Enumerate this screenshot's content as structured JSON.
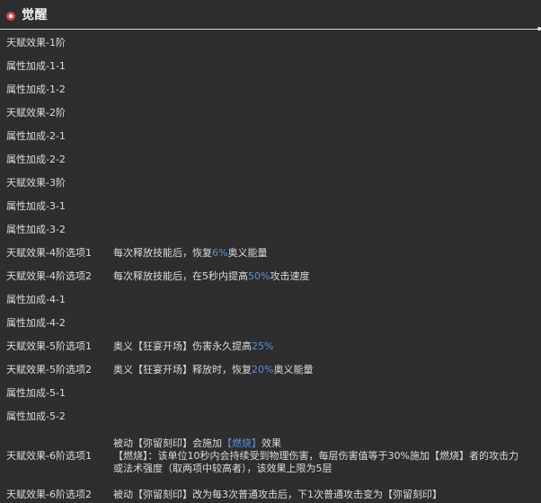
{
  "header": {
    "title": "觉醒",
    "icon": "awaken-bullet-icon",
    "accent_color": "#e0525a"
  },
  "rows": [
    {
      "label": "天赋效果-1阶"
    },
    {
      "label": "属性加成-1-1"
    },
    {
      "label": "属性加成-1-2"
    },
    {
      "label": "天赋效果-2阶"
    },
    {
      "label": "属性加成-2-1"
    },
    {
      "label": "属性加成-2-2"
    },
    {
      "label": "天赋效果-3阶"
    },
    {
      "label": "属性加成-3-1"
    },
    {
      "label": "属性加成-3-2"
    },
    {
      "label": "天赋效果-4阶选项1",
      "desc_pre": "每次释放技能后，恢复",
      "desc_hl": "6%",
      "desc_post": "奥义能量"
    },
    {
      "label": "天赋效果-4阶选项2",
      "desc_pre": "每次释放技能后，在5秒内提高",
      "desc_hl": "50%",
      "desc_post": "攻击速度"
    },
    {
      "label": "属性加成-4-1"
    },
    {
      "label": "属性加成-4-2"
    },
    {
      "label": "天赋效果-5阶选项1",
      "desc_pre": "奥义【狂宴开场】伤害永久提高",
      "desc_hl": "25%",
      "desc_post": ""
    },
    {
      "label": "天赋效果-5阶选项2",
      "desc_pre": "奥义【狂宴开场】释放时，恢复",
      "desc_hl": "20%",
      "desc_post": "奥义能量"
    },
    {
      "label": "属性加成-5-1"
    },
    {
      "label": "属性加成-5-2"
    }
  ],
  "row6_1": {
    "label": "天赋效果-6阶选项1",
    "line1_pre": "被动【弥留刻印】会施加",
    "line1_hl": "【燃烧】",
    "line1_post": "效果",
    "line2": "【燃烧】：该单位10秒内会持续受到物理伤害，每层伤害值等于30%施加【燃烧】者的攻击力",
    "line3": "或法术强度（取两项中较高者），该效果上限为5层"
  },
  "row6_2": {
    "label": "天赋效果-6阶选项2",
    "desc": "被动【弥留刻印】改为每3次普通攻击后，下1次普通攻击变为【弥留刻印】"
  }
}
